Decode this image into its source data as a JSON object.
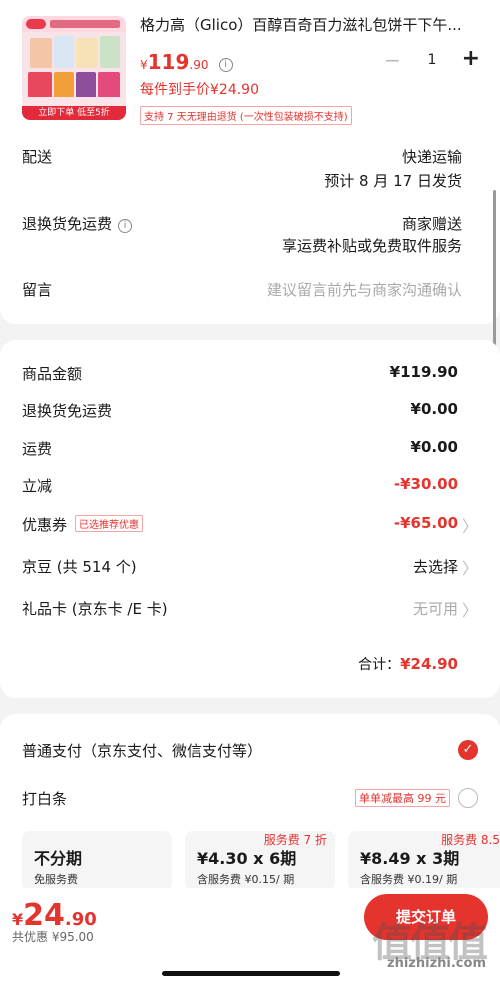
{
  "product": {
    "title": "格力高（Glico）百醇百奇百力滋礼包饼干下午...",
    "price_currency": "¥",
    "price_int": "119",
    "price_dec": ".90",
    "each_price": "每件到手价¥24.90",
    "return_tag": "支持 7 天无理由退货 (一次性包装破损不支持)",
    "thumb_band": "立即下单 低至5折",
    "quantity": "1",
    "minus": "−",
    "plus": "+",
    "info_glyph": "i"
  },
  "delivery": {
    "label": "配送",
    "method": "快递运输",
    "eta": "预计 8 月 17 日发货"
  },
  "return_fee": {
    "label": "退换货免运费",
    "value1": "商家赠送",
    "value2": "享运费补贴或免费取件服务"
  },
  "message": {
    "label": "留言",
    "placeholder": "建议留言前先与商家沟通确认"
  },
  "summary": {
    "rows": [
      {
        "label": "商品金额",
        "value": "¥119.90"
      },
      {
        "label": "退换货免运费",
        "value": "¥0.00"
      },
      {
        "label": "运费",
        "value": "¥0.00"
      },
      {
        "label": "立减",
        "value": "-¥30.00"
      },
      {
        "label": "优惠券",
        "tag": "已选推荐优惠",
        "value": "-¥65.00"
      },
      {
        "label": "京豆 (共 514 个)",
        "value": "去选择"
      },
      {
        "label": "礼品卡 (京东卡 /E 卡)",
        "value": "无可用"
      }
    ],
    "total_label": "合计：",
    "total_value": "¥24.90",
    "chevron": "〉"
  },
  "payment": {
    "option1": "普通支付（京东支付、微信支付等）",
    "check_glyph": "✓",
    "option2": "打白条",
    "option2_promo": "单单减最高 99 元",
    "plans": [
      {
        "title": "不分期",
        "sub": "免服务费",
        "badge": ""
      },
      {
        "title": "¥4.30 x 6期",
        "sub": "含服务费 ¥0.15/ 期",
        "badge": "服务费 7 折"
      },
      {
        "title": "¥8.49 x 3期",
        "sub": "含服务费 ¥0.19/ 期",
        "badge": "服务费 8.5"
      }
    ]
  },
  "bottom": {
    "currency": "¥",
    "price_int": "24",
    "price_dec": ".90",
    "discount": "共优惠 ¥95.00",
    "submit": "提交订单",
    "watermark_logo": "值值值",
    "watermark": "zhizhizhi.com"
  }
}
